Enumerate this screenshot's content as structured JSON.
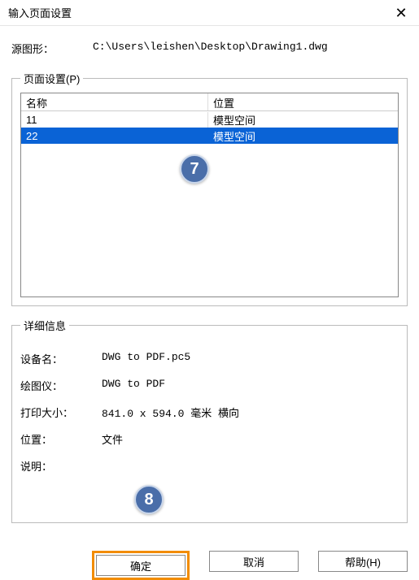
{
  "titlebar": {
    "title": "输入页面设置",
    "close_glyph": "✕"
  },
  "source": {
    "label": "源图形：",
    "value": "C:\\Users\\leishen\\Desktop\\Drawing1.dwg"
  },
  "page_setup": {
    "legend": "页面设置(P)",
    "columns": {
      "name": "名称",
      "location": "位置"
    },
    "rows": [
      {
        "name": "11",
        "location": "模型空间",
        "selected": false
      },
      {
        "name": "22",
        "location": "模型空间",
        "selected": true
      }
    ],
    "badge7": "7"
  },
  "details": {
    "legend": "详细信息",
    "device_label": "设备名：",
    "device_value": "DWG to PDF.pc5",
    "plotter_label": "绘图仪：",
    "plotter_value": "DWG to PDF",
    "size_label": "打印大小：",
    "size_value": "841.0 x 594.0 毫米 横向",
    "location_label": "位置：",
    "location_value": "文件",
    "desc_label": "说明：",
    "desc_value": "",
    "badge8": "8"
  },
  "footer": {
    "ok": "确定",
    "cancel": "取消",
    "help": "帮助(H)"
  }
}
